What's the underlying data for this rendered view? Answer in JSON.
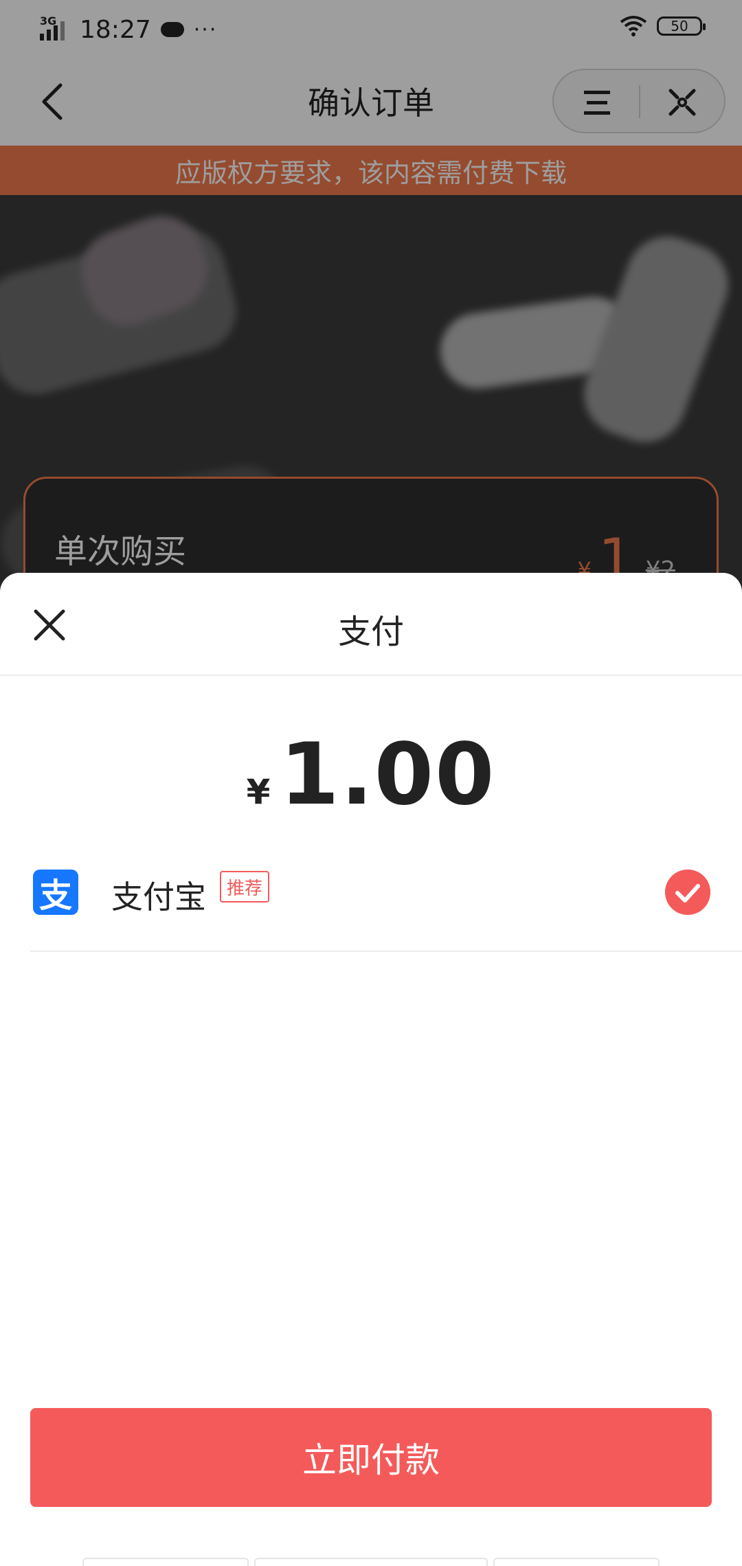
{
  "status_bar": {
    "network": "3G",
    "time": "18:27",
    "more": "···",
    "battery": "50"
  },
  "nav": {
    "title": "确认订单"
  },
  "notice": {
    "text": "应版权方要求，该内容需付费下载"
  },
  "product_card": {
    "title": "单次购买",
    "currency": "¥",
    "price": "1",
    "original_price": "¥2"
  },
  "payment_sheet": {
    "title": "支付",
    "currency": "¥",
    "amount": "1.00",
    "method": {
      "name": "支付宝",
      "badge": "推荐",
      "icon_glyph": "支",
      "selected": true
    },
    "pay_button": "立即付款"
  },
  "colors": {
    "accent": "#f55a5a",
    "notice_bg": "#f07a4c",
    "alipay_blue": "#1677ff"
  },
  "icons": [
    "back-icon",
    "menu-icon",
    "close-icon",
    "alipay-icon",
    "check-icon"
  ]
}
